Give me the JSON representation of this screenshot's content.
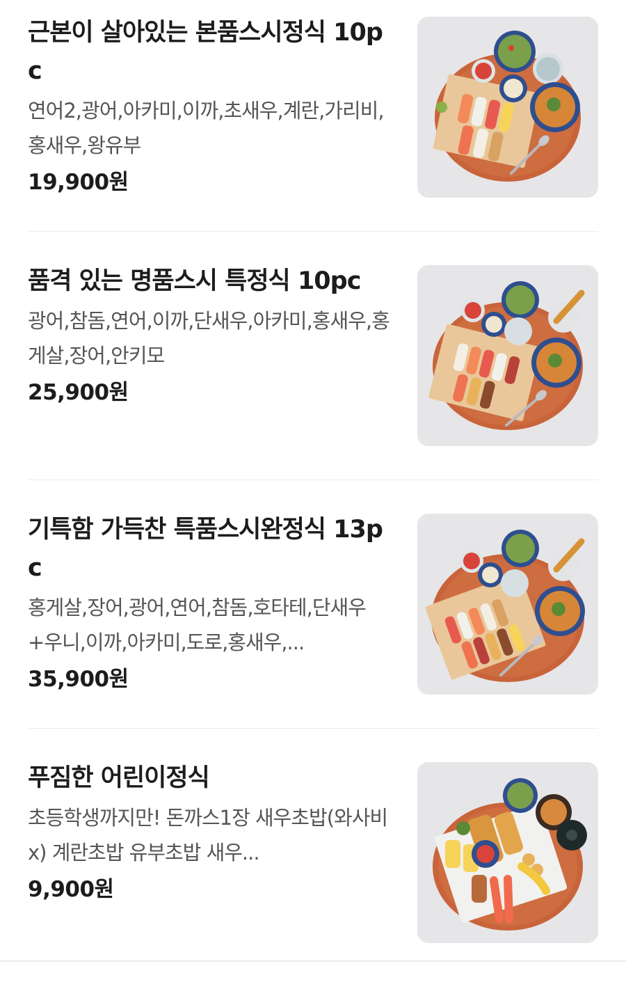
{
  "menu": {
    "items": [
      {
        "name": "근본이 살아있는 본품스시정식 10pc",
        "description": "연어2,광어,아카미,이까,초새우,계란,가리비,홍새우,왕유부",
        "price": "19,900원",
        "image_icon": "sushi-set-plate-photo"
      },
      {
        "name": "품격 있는 명품스시 특정식 10pc",
        "description": "광어,참돔,연어,이까,단새우,아카미,홍새우,홍게살,장어,안키모",
        "price": "25,900원",
        "image_icon": "premium-sushi-set-plate-photo"
      },
      {
        "name": "기특함 가득찬 특품스시완정식 13pc",
        "description": "홍게살,장어,광어,연어,참돔,호타테,단새우+우니,이까,아카미,도로,홍새우,...",
        "price": "35,900원",
        "image_icon": "special-sushi-full-set-plate-photo"
      },
      {
        "name": "푸짐한 어린이정식",
        "description": "초등학생까지만! 돈까스1장 새우초밥(와사비x) 계란초밥 유부초밥 새우...",
        "price": "9,900원",
        "image_icon": "kids-set-plate-photo"
      }
    ]
  },
  "colors": {
    "background": "#ffffff",
    "title_text": "#1c1c1c",
    "description_text": "#555555",
    "price_text": "#1c1c1c",
    "divider": "#ececec",
    "photo_background": "#e7e7e9",
    "tray_wood": "#c9643a"
  }
}
